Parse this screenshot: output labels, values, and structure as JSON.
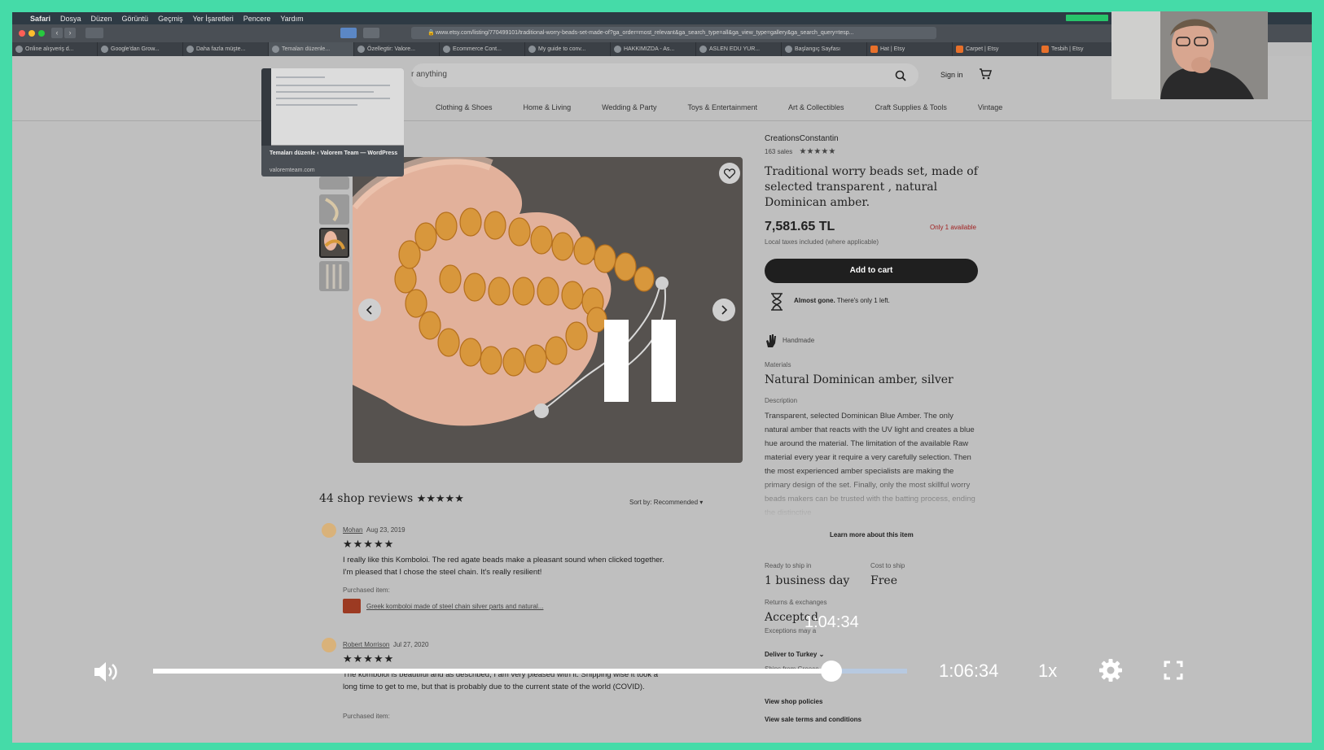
{
  "menubar": {
    "items": [
      "Safari",
      "Dosya",
      "Düzen",
      "Görüntü",
      "Geçmiş",
      "Yer İşaretleri",
      "Pencere",
      "Yardım"
    ]
  },
  "browser": {
    "url": "www.etsy.com/listing/770499101/traditional-worry-beads-set-made-of?ga_order=most_relevant&ga_search_type=all&ga_view_type=gallery&ga_search_query=tesp...",
    "tabs": [
      {
        "label": "Online alışveriş d..."
      },
      {
        "label": "Google'dan Grow..."
      },
      {
        "label": "Daha fazla müşte..."
      },
      {
        "label": "Temaları düzenle..."
      },
      {
        "label": "Özellegtir: Valore..."
      },
      {
        "label": "Ecommerce Cont..."
      },
      {
        "label": "My guide to conv..."
      },
      {
        "label": "HAKKIMIZDA - As..."
      },
      {
        "label": "ASLEN EDU YUR..."
      },
      {
        "label": "Başlangıç Sayfası"
      },
      {
        "label": "Hat | Etsy"
      },
      {
        "label": "Carpet | Etsy"
      },
      {
        "label": "Tesbih | Etsy"
      }
    ],
    "tab_preview": {
      "title": "Temaları düzenle ‹ Valorem Team — WordPress",
      "url": "valoremteam.com"
    }
  },
  "etsy": {
    "search_placeholder": "r anything",
    "sign_in": "Sign in",
    "categories": [
      "Clothing & Shoes",
      "Home & Living",
      "Wedding & Party",
      "Toys & Entertainment",
      "Art & Collectibles",
      "Craft Supplies & Tools",
      "Vintage"
    ]
  },
  "listing": {
    "shop_name": "CreationsConstantin",
    "sales": "163 sales",
    "stars": "★★★★★",
    "title": "Traditional worry beads set, made of selected transparent , natural Dominican amber.",
    "price": "7,581.65 TL",
    "availability": "Only 1 available",
    "tax_note": "Local taxes included (where applicable)",
    "add_to_cart": "Add to cart",
    "almost_gone_bold": "Almost gone.",
    "almost_gone_rest": " There's only 1 left.",
    "handmade": "Handmade",
    "materials_label": "Materials",
    "materials": "Natural Dominican amber, silver",
    "description_label": "Description",
    "description": "Transparent, selected Dominican Blue Amber. The only natural amber that reacts with the UV light and creates a blue hue around the material. The limitation of the available Raw material every year it require a very carefully selection. Then the most experienced amber specialists are making the primary design of the set. Finally, only the most skillful worry beads makers can be trusted with the batting process, ending the distinctive",
    "learn_more": "Learn more about this item",
    "ready_label": "Ready to ship in",
    "ready_value": "1 business day",
    "cost_label": "Cost to ship",
    "cost_value": "Free",
    "returns_label": "Returns & exchanges",
    "returns_value": "Accepted",
    "exceptions": "Exceptions may a",
    "deliver_to": "Deliver to Turkey",
    "ships_from": "Ships from Greece",
    "view_policies": "View shop policies",
    "view_terms": "View sale terms and conditions"
  },
  "reviews": {
    "heading": "44 shop reviews",
    "heading_stars": "★★★★★",
    "sort": "Sort by: Recommended",
    "items": [
      {
        "name": "Mohan",
        "date": "Aug 23, 2019",
        "stars": "★★★★★",
        "text": "I really like this Komboloi. The red agate beads make a pleasant sound when clicked together. I'm pleased that I chose the steel chain. It's really resilient!",
        "purchased_label": "Purchased item:",
        "purchased_item": "Greek komboloi made of steel chain silver parts and natural..."
      },
      {
        "name": "Robert Morrison",
        "date": "Jul 27, 2020",
        "stars": "★★★★★",
        "text": "The komboloi is beautiful and as described, I am very pleased with it. Shipping wise it took a long time to get to me, but that is probably due to the current state of the world (COVID).",
        "purchased_label": "Purchased item:"
      }
    ]
  },
  "player": {
    "hover_time": "1:04:34",
    "duration": "1:06:34",
    "speed": "1x",
    "progress": 0.9,
    "hover_fraction": 0.903,
    "buffered": 1.0,
    "state": "paused"
  },
  "colors": {
    "frame": "#45dba8",
    "etsy_accent": "#e8702a",
    "availability": "#a12020"
  }
}
